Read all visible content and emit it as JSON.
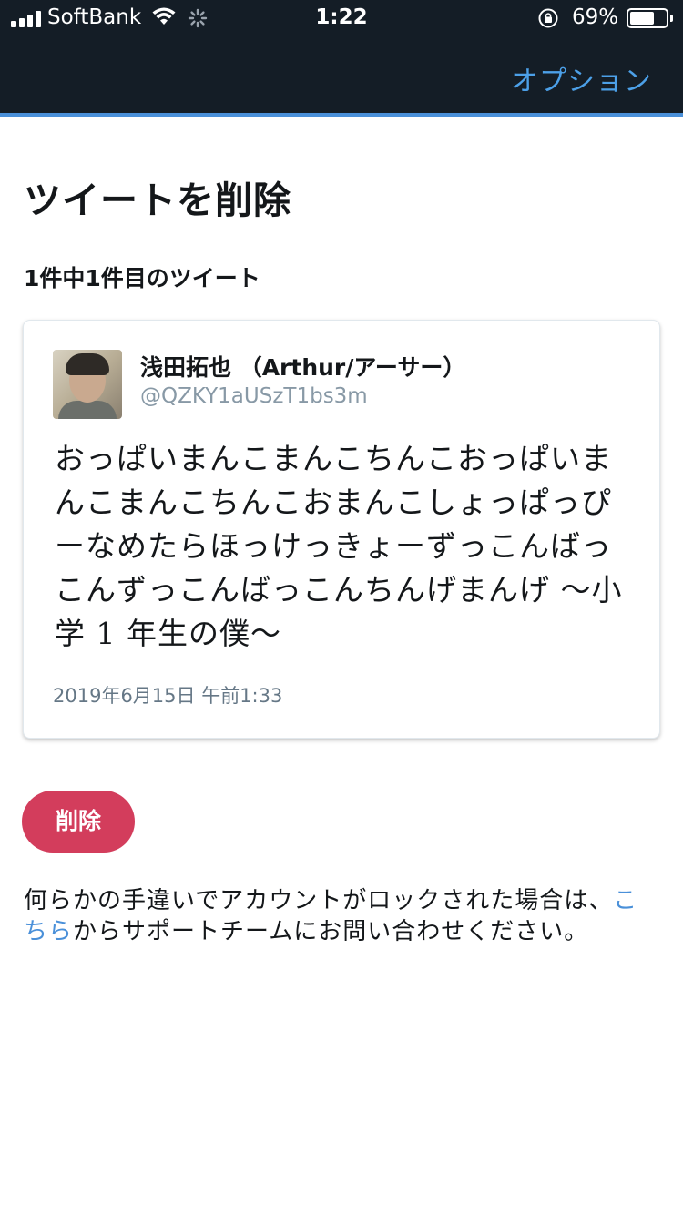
{
  "status_bar": {
    "carrier": "SoftBank",
    "time": "1:22",
    "battery_percent": "69%",
    "battery_level": 0.69
  },
  "header": {
    "options_label": "オプション"
  },
  "page": {
    "title": "ツイートを削除",
    "subtitle": "1件中1件目のツイート"
  },
  "tweet": {
    "author_name": "浅田拓也 （Arthur/アーサー）",
    "author_handle": "@QZKY1aUSzT1bs3m",
    "text": "おっぱいまんこまんこちんこおっぱいまんこまんこちんこおまんこしょっぱっぴーなめたらほっけっきょーずっこんばっこんずっこんばっこんちんげまんげ 〜小学 1 年生の僕〜",
    "date": "2019年6月15日 午前1:33"
  },
  "actions": {
    "delete_label": "削除"
  },
  "notice": {
    "before_link": "何らかの手違いでアカウントがロックされた場合は、",
    "link_text": "こちら",
    "after_link": "からサポートチームにお問い合わせください。"
  },
  "colors": {
    "header_bg": "#141d26",
    "accent_blue": "#4a90d9",
    "delete_red": "#d33d5c"
  }
}
